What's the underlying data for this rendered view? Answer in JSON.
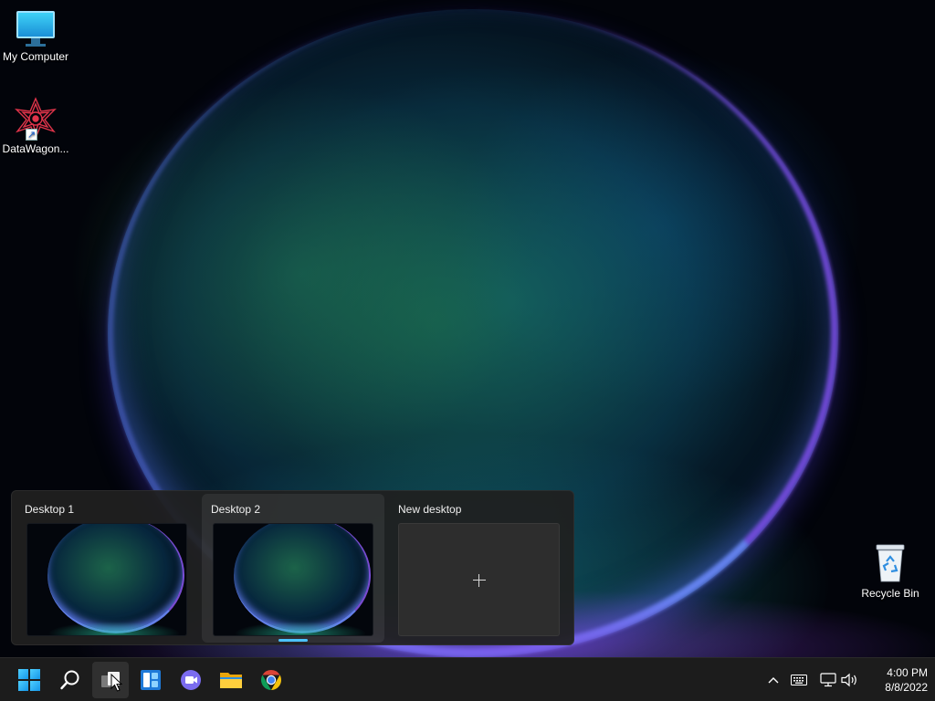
{
  "desktop": {
    "icons": [
      {
        "label": "My Computer",
        "icon": "monitor-icon"
      },
      {
        "label": "DataWagon...",
        "icon": "datawagon-app-icon"
      },
      {
        "label": "Recycle Bin",
        "icon": "recycle-bin-icon"
      }
    ]
  },
  "taskview": {
    "desktops": [
      {
        "label": "Desktop 1",
        "active": false
      },
      {
        "label": "Desktop 2",
        "active": true
      }
    ],
    "new_desktop_label": "New desktop"
  },
  "taskbar": {
    "buttons": [
      "start-icon",
      "search-icon",
      "task-view-icon",
      "widgets-icon",
      "chat-icon",
      "file-explorer-icon",
      "chrome-icon"
    ],
    "tray": [
      "chevron-up-icon",
      "keyboard-icon",
      "network-icon",
      "volume-icon"
    ],
    "clock": {
      "time": "4:00 PM",
      "date": "8/8/2022"
    }
  },
  "colors": {
    "accent": "#4cc2ff",
    "taskbar_bg": "#1c1c1c",
    "flyout_bg": "#202020"
  }
}
